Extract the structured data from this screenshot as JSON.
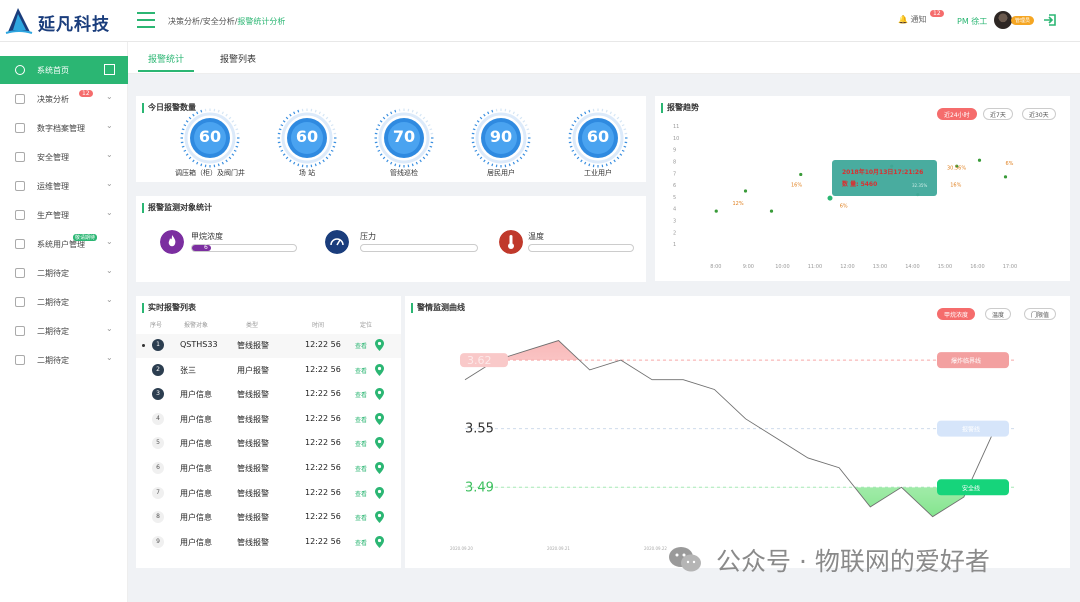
{
  "brand": {
    "name": "延凡科技"
  },
  "header": {
    "breadcrumb": {
      "part1": "决策分析/安全分析/",
      "part2": "报警统计分析"
    },
    "notify_label": "通知",
    "notify_count": "12",
    "user_name": "PM 徐工",
    "role_tag": "管理员"
  },
  "sidebar": {
    "items": [
      {
        "label": "系统首页"
      },
      {
        "label": "决策分析",
        "badge": "12"
      },
      {
        "label": "数字档案管理"
      },
      {
        "label": "安全管理"
      },
      {
        "label": "运维管理"
      },
      {
        "label": "生产管理"
      },
      {
        "label": "系统用户管理",
        "tag": "敬请期待"
      },
      {
        "label": "二期待定"
      },
      {
        "label": "二期待定"
      },
      {
        "label": "二期待定"
      },
      {
        "label": "二期待定"
      }
    ]
  },
  "tabs": [
    {
      "label": "报警统计"
    },
    {
      "label": "报警列表"
    }
  ],
  "today_alarms": {
    "title": "今日报警数量",
    "gauges": [
      {
        "value": "60",
        "label": "调压箱（柜）及阀门井"
      },
      {
        "value": "60",
        "label": "场 站"
      },
      {
        "value": "70",
        "label": "管线巡检"
      },
      {
        "value": "90",
        "label": "居民用户"
      },
      {
        "value": "60",
        "label": "工业用户"
      }
    ]
  },
  "monitor": {
    "title": "报警监测对象统计",
    "items": [
      {
        "label": "甲烷浓度",
        "bar_text": "6个",
        "fill": 0.18,
        "color": "#7b2ea0"
      },
      {
        "label": "压力",
        "bar_text": "",
        "fill": 0,
        "color": "#1a3d7c"
      },
      {
        "label": "温度",
        "bar_text": "",
        "fill": 0,
        "color": "#c0392b"
      }
    ]
  },
  "trend": {
    "title": "报警趋势",
    "buttons": [
      {
        "label": "近24小时",
        "on": true
      },
      {
        "label": "近7天",
        "on": false
      },
      {
        "label": "近30天",
        "on": false
      }
    ],
    "tooltip": {
      "time": "2018年10月13日17:21:26",
      "value": "数 量: 5460",
      "pct": "32.35%"
    }
  },
  "realtime": {
    "title": "实时报警列表",
    "headers": {
      "num": "序号",
      "obj": "报警对象",
      "type": "类型",
      "time": "时间",
      "loc": "定位"
    },
    "rows": [
      {
        "n": "1",
        "obj": "QSTHS33",
        "type": "管线报警",
        "time": "12:22 56",
        "loc": "查看"
      },
      {
        "n": "2",
        "obj": "张三",
        "type": "用户报警",
        "time": "12:22 56",
        "loc": "查看"
      },
      {
        "n": "3",
        "obj": "用户信息",
        "type": "管线报警",
        "time": "12:22 56",
        "loc": "查看"
      },
      {
        "n": "4",
        "obj": "用户信息",
        "type": "管线报警",
        "time": "12:22 56",
        "loc": "查看"
      },
      {
        "n": "5",
        "obj": "用户信息",
        "type": "管线报警",
        "time": "12:22 56",
        "loc": "查看"
      },
      {
        "n": "6",
        "obj": "用户信息",
        "type": "管线报警",
        "time": "12:22 56",
        "loc": "查看"
      },
      {
        "n": "7",
        "obj": "用户信息",
        "type": "管线报警",
        "time": "12:22 56",
        "loc": "查看"
      },
      {
        "n": "8",
        "obj": "用户信息",
        "type": "管线报警",
        "time": "12:22 56",
        "loc": "查看"
      },
      {
        "n": "9",
        "obj": "用户信息",
        "type": "管线报警",
        "time": "12:22 56",
        "loc": "查看"
      }
    ]
  },
  "curve": {
    "title": "警情监测曲线",
    "buttons": [
      {
        "label": "甲烷浓度",
        "on": true
      },
      {
        "label": "温度",
        "on": false
      },
      {
        "label": "门限值",
        "on": false
      }
    ],
    "line_labels": {
      "upper": "爆炸临界线",
      "middle": "报警线",
      "lower": "安全线"
    },
    "threshold_labels": {
      "upper": "3.62",
      "middle": "3.55",
      "lower": "3.49"
    }
  },
  "chart_data": [
    {
      "type": "scatter",
      "title": "报警趋势",
      "x_ticks": [
        "8:00",
        "9:00",
        "10:00",
        "11:00",
        "12:00",
        "13:00",
        "14:00",
        "15:00",
        "16:00",
        "17:00"
      ],
      "y_ticks": [
        "1",
        "2",
        "3",
        "4",
        "5",
        "6",
        "7",
        "8",
        "9",
        "10",
        "11"
      ],
      "ylim": [
        0,
        11
      ],
      "xlim": [
        7.5,
        17.5
      ],
      "points": [
        {
          "x": 8.0,
          "y": 3.8
        },
        {
          "x": 8.9,
          "y": 5.5
        },
        {
          "x": 9.7,
          "y": 3.8
        },
        {
          "x": 10.6,
          "y": 6.9
        },
        {
          "x": 11.5,
          "y": 4.9
        },
        {
          "x": 13.4,
          "y": 7.6
        },
        {
          "x": 14.2,
          "y": 5.2
        },
        {
          "x": 15.4,
          "y": 7.6
        },
        {
          "x": 16.1,
          "y": 8.1
        },
        {
          "x": 16.9,
          "y": 6.7
        }
      ],
      "highlight": {
        "x": 11.5,
        "y": 4.9
      },
      "labels": [
        {
          "x": 8.5,
          "y": 4.3,
          "text": "12%"
        },
        {
          "x": 10.3,
          "y": 5.9,
          "text": "16%"
        },
        {
          "x": 11.8,
          "y": 4.1,
          "text": "6%"
        },
        {
          "x": 15.1,
          "y": 7.3,
          "text": "30.56%"
        },
        {
          "x": 15.2,
          "y": 5.9,
          "text": "16%"
        },
        {
          "x": 16.9,
          "y": 7.7,
          "text": "6%"
        }
      ]
    },
    {
      "type": "area",
      "title": "警情监测曲线",
      "x_ticks": [
        "2020.09.20",
        "2020.09.21",
        "2020.09.22"
      ],
      "x": [
        0,
        1,
        2,
        3,
        4,
        5,
        6,
        7,
        8,
        9,
        10,
        11,
        12,
        13,
        14,
        15
      ],
      "values": [
        3.6,
        3.62,
        3.63,
        3.64,
        3.61,
        3.62,
        3.6,
        3.6,
        3.59,
        3.56,
        3.54,
        3.52,
        3.51,
        3.47,
        3.49,
        3.46,
        3.48,
        3.55
      ],
      "ylim": [
        3.43,
        3.66
      ],
      "thresholds": {
        "upper": 3.62,
        "middle": 3.55,
        "lower": 3.49
      }
    }
  ]
}
